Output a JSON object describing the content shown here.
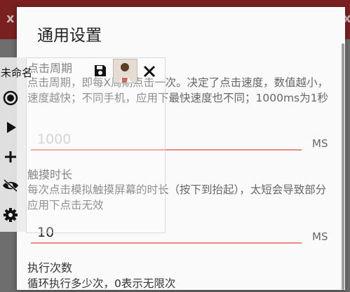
{
  "app_bar": {
    "left_glyph": "x",
    "right_glyph": "x"
  },
  "dialog": {
    "title": "通用设置",
    "sections": [
      {
        "title": "点击周期",
        "description": "点击周期，即每X周期点击一次。决定了点击速度，数值越小，速度越快；不同手机，应用下最快速度也不同；1000ms为1秒",
        "value": "1000",
        "unit": "MS"
      },
      {
        "title": "触摸时长",
        "description": "每次点击模拟触摸屏幕的时长（按下到抬起），太短会导致部分应用下点击无效",
        "value": "10",
        "unit": "MS"
      },
      {
        "title": "执行次数",
        "description": "循环执行多少次，0表示无限次"
      }
    ]
  },
  "floating_panel": {
    "name": "未命名",
    "icons": [
      "record-icon",
      "play-icon",
      "add-icon",
      "hide-icon",
      "settings-icon",
      "save-icon",
      "close-icon"
    ]
  }
}
